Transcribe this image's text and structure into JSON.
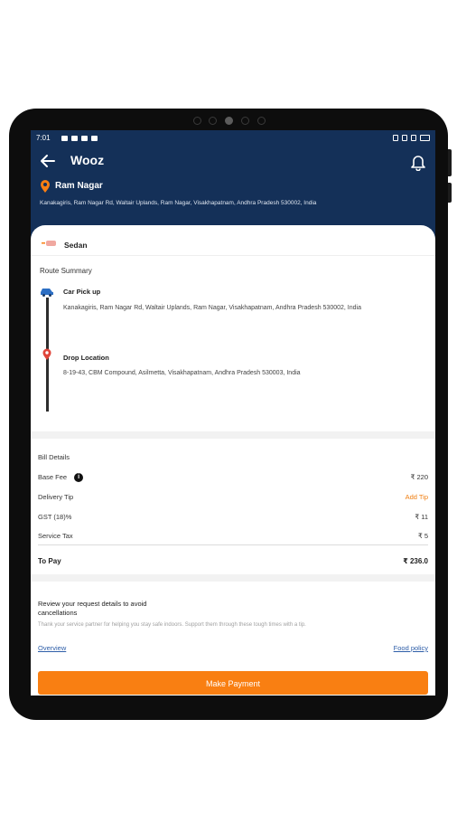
{
  "status_bar": {
    "time": "7:01"
  },
  "header": {
    "title": "Wooz",
    "location_name": "Ram Nagar",
    "location_address": "Kanakagiris, Ram Nagar Rd, Waltair Uplands, Ram Nagar, Visakhapatnam, Andhra Pradesh 530002, India"
  },
  "vehicle": {
    "type": "Sedan",
    "logo_text": "Wooz"
  },
  "route": {
    "title": "Route Summary",
    "pickup_label": "Car Pick up",
    "pickup_address": "Kanakagiris, Ram Nagar Rd, Waltair Uplands, Ram Nagar, Visakhapatnam, Andhra Pradesh 530002, India",
    "drop_label": "Drop Location",
    "drop_address": "8-19-43, CBM Compound, Asilmetta, Visakhapatnam, Andhra Pradesh 530003, India"
  },
  "bill": {
    "title": "Bill Details",
    "base_fee_label": "Base Fee",
    "base_fee": "₹ 220",
    "delivery_tip_label": "Delivery Tip",
    "add_tip": "Add Tip",
    "gst_label": "GST (18)%",
    "gst": "₹ 11",
    "service_tax_label": "Service Tax",
    "service_tax": "₹ 5",
    "to_pay_label": "To Pay",
    "to_pay": "₹ 236.0"
  },
  "review": {
    "heading": "Review your request details to avoid cancellations",
    "thanks": "Thank your service partner for helping you stay safe indoors. Support them through these tough times with a tip.",
    "overview_link": "Overview",
    "food_policy_link": "Food policy"
  },
  "payment": {
    "button_label": "Make Payment"
  },
  "colors": {
    "header": "#143058",
    "accent": "#f97f12",
    "link": "#2e5ea8"
  }
}
